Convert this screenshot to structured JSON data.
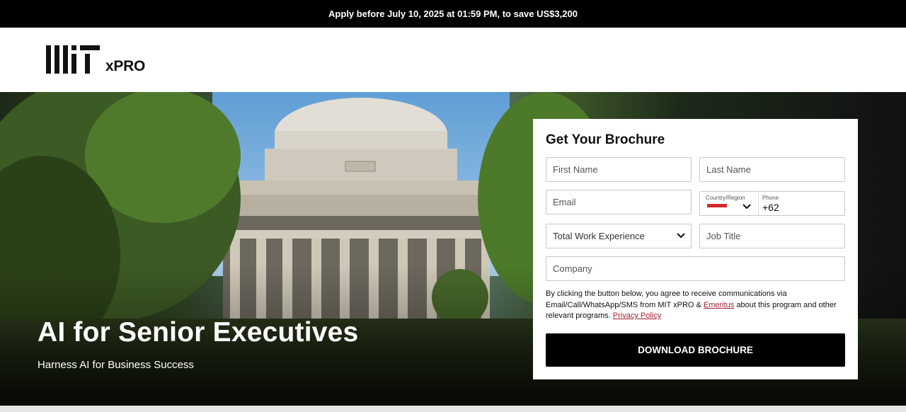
{
  "banner": {
    "text": "Apply before July 10, 2025 at 01:59 PM, to save US$3,200"
  },
  "header": {
    "logo_mark": "MIT",
    "logo_product": "xPRO"
  },
  "hero": {
    "title": "AI for Senior Executives",
    "subtitle": "Harness AI for Business Success"
  },
  "form": {
    "title": "Get Your Brochure",
    "first_name_placeholder": "First Name",
    "last_name_placeholder": "Last Name",
    "email_placeholder": "Email",
    "country_label": "Country/Region",
    "phone_label": "Phone",
    "phone_value": "+62",
    "work_experience_selected": "Total Work Experience",
    "job_title_placeholder": "Job Title",
    "company_placeholder": "Company",
    "consent_text_1": "By clicking the button below, you agree to receive communications via Email/Call/WhatsApp/SMS from MIT xPRO & ",
    "consent_link_emeritus": "Emeritus",
    "consent_text_2": " about this program and other relevant programs. ",
    "consent_link_privacy": "Privacy Policy",
    "submit_label": "DOWNLOAD BROCHURE"
  },
  "colors": {
    "accent_link": "#a31f34",
    "button_bg": "#000000",
    "banner_bg": "#000000"
  },
  "icons": {
    "select_chevron": "chevron-down-icon",
    "country_flag": "indonesia-flag-icon"
  }
}
